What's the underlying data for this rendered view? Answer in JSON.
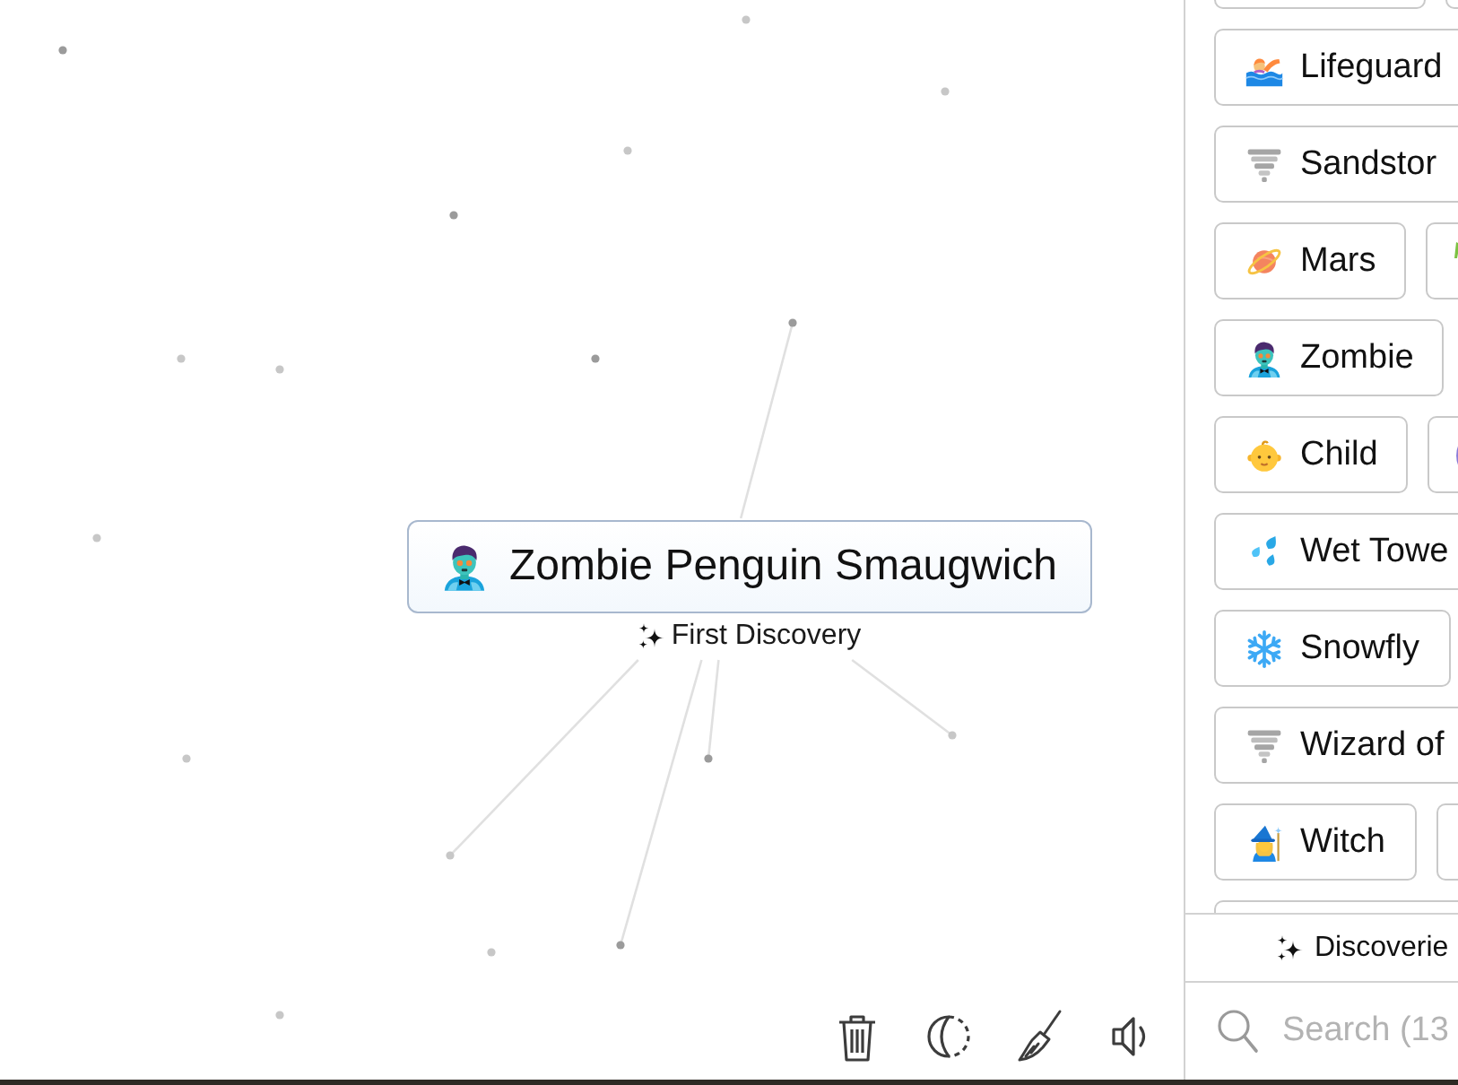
{
  "canvas": {
    "element": {
      "label": "Zombie Penguin Smaugwich",
      "badge": "First Discovery"
    }
  },
  "sidebar": {
    "rows": [
      {
        "items": [
          {
            "kind": "clipped_top"
          },
          {
            "kind": "clipped_top"
          }
        ]
      },
      {
        "items": [
          {
            "kind": "cut",
            "label": "Lifeguard"
          }
        ]
      },
      {
        "items": [
          {
            "kind": "cut",
            "label": "Sandstor"
          }
        ]
      },
      {
        "items": [
          {
            "kind": "full",
            "label": "Mars"
          },
          {
            "kind": "edge"
          }
        ]
      },
      {
        "items": [
          {
            "kind": "full",
            "label": "Zombie"
          }
        ]
      },
      {
        "items": [
          {
            "kind": "full",
            "label": "Child"
          },
          {
            "kind": "edge"
          }
        ]
      },
      {
        "items": [
          {
            "kind": "cut",
            "label": "Wet Towe"
          }
        ]
      },
      {
        "items": [
          {
            "kind": "full",
            "label": "Snowfly"
          }
        ]
      },
      {
        "items": [
          {
            "kind": "cut",
            "label": "Wizard of"
          }
        ]
      },
      {
        "items": [
          {
            "kind": "full",
            "label": "Witch"
          },
          {
            "kind": "edge"
          }
        ]
      },
      {
        "items": [
          {
            "kind": "clipped_bottom"
          }
        ]
      }
    ],
    "tab": {
      "label": "Discoverie"
    },
    "search": {
      "placeholder": "Search (13"
    }
  }
}
